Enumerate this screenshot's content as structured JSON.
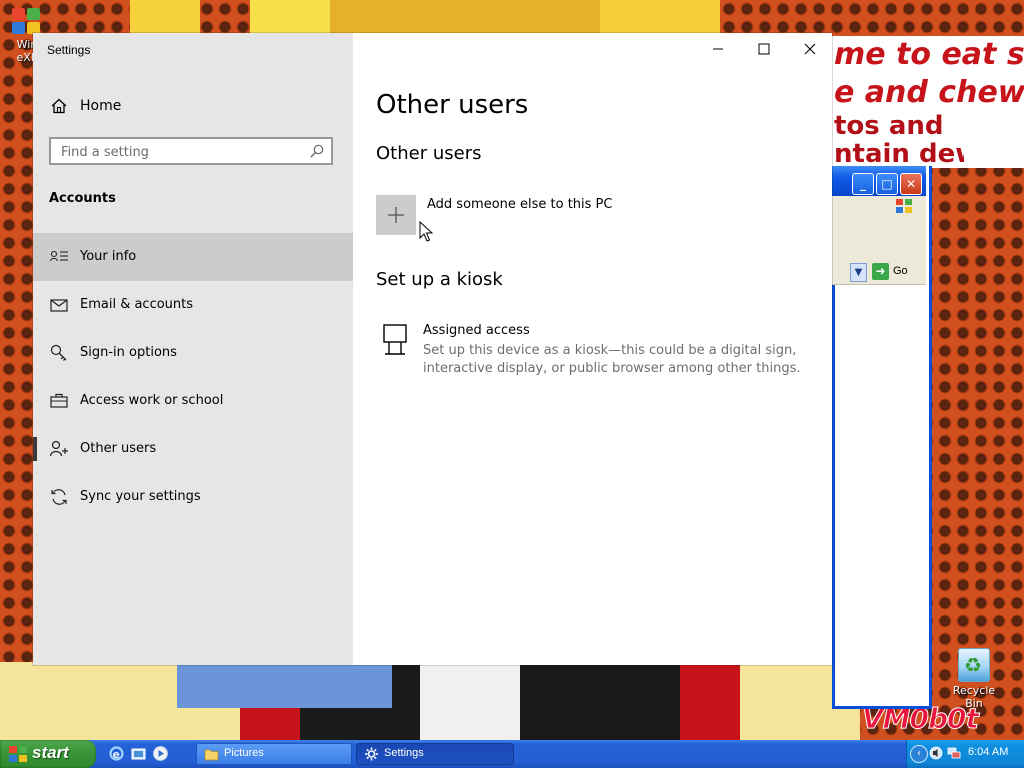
{
  "desktop": {
    "icons": [
      {
        "label": "Win eXP"
      },
      {
        "label": "Recycle Bin"
      }
    ],
    "wallpaper_text": [
      "me to eat shit",
      "e and chew",
      "tos and",
      "ntain dew"
    ],
    "watermark": "VM0b0t"
  },
  "background_window": {
    "go_label": "Go"
  },
  "settings": {
    "title": "Settings",
    "home_label": "Home",
    "search": {
      "placeholder": "Find a setting",
      "value": ""
    },
    "section_heading": "Accounts",
    "nav": [
      {
        "label": "Your info",
        "icon": "person-card-icon",
        "selected": true
      },
      {
        "label": "Email & accounts",
        "icon": "mail-icon",
        "selected": false
      },
      {
        "label": "Sign-in options",
        "icon": "key-icon",
        "selected": false
      },
      {
        "label": "Access work or school",
        "icon": "briefcase-icon",
        "selected": false
      },
      {
        "label": "Other users",
        "icon": "person-add-icon",
        "selected": false
      },
      {
        "label": "Sync your settings",
        "icon": "sync-icon",
        "selected": false
      }
    ],
    "main": {
      "page_title": "Other users",
      "other_users_heading": "Other users",
      "add_label": "Add someone else to this PC",
      "kiosk_heading": "Set up a kiosk",
      "assigned_access_title": "Assigned access",
      "assigned_access_desc": "Set up this device as a kiosk—this could be a digital sign, interactive display, or public browser among other things."
    }
  },
  "taskbar": {
    "start_label": "start",
    "buttons": [
      {
        "label": "Pictures",
        "active": false
      },
      {
        "label": "Settings",
        "active": true
      }
    ],
    "clock": "6:04 AM"
  },
  "colors": {
    "sidebar_bg": "#e6e6e6",
    "selected_bg": "#cccccc",
    "taskbar_blue": "#235ed3",
    "start_green": "#3c963a"
  }
}
